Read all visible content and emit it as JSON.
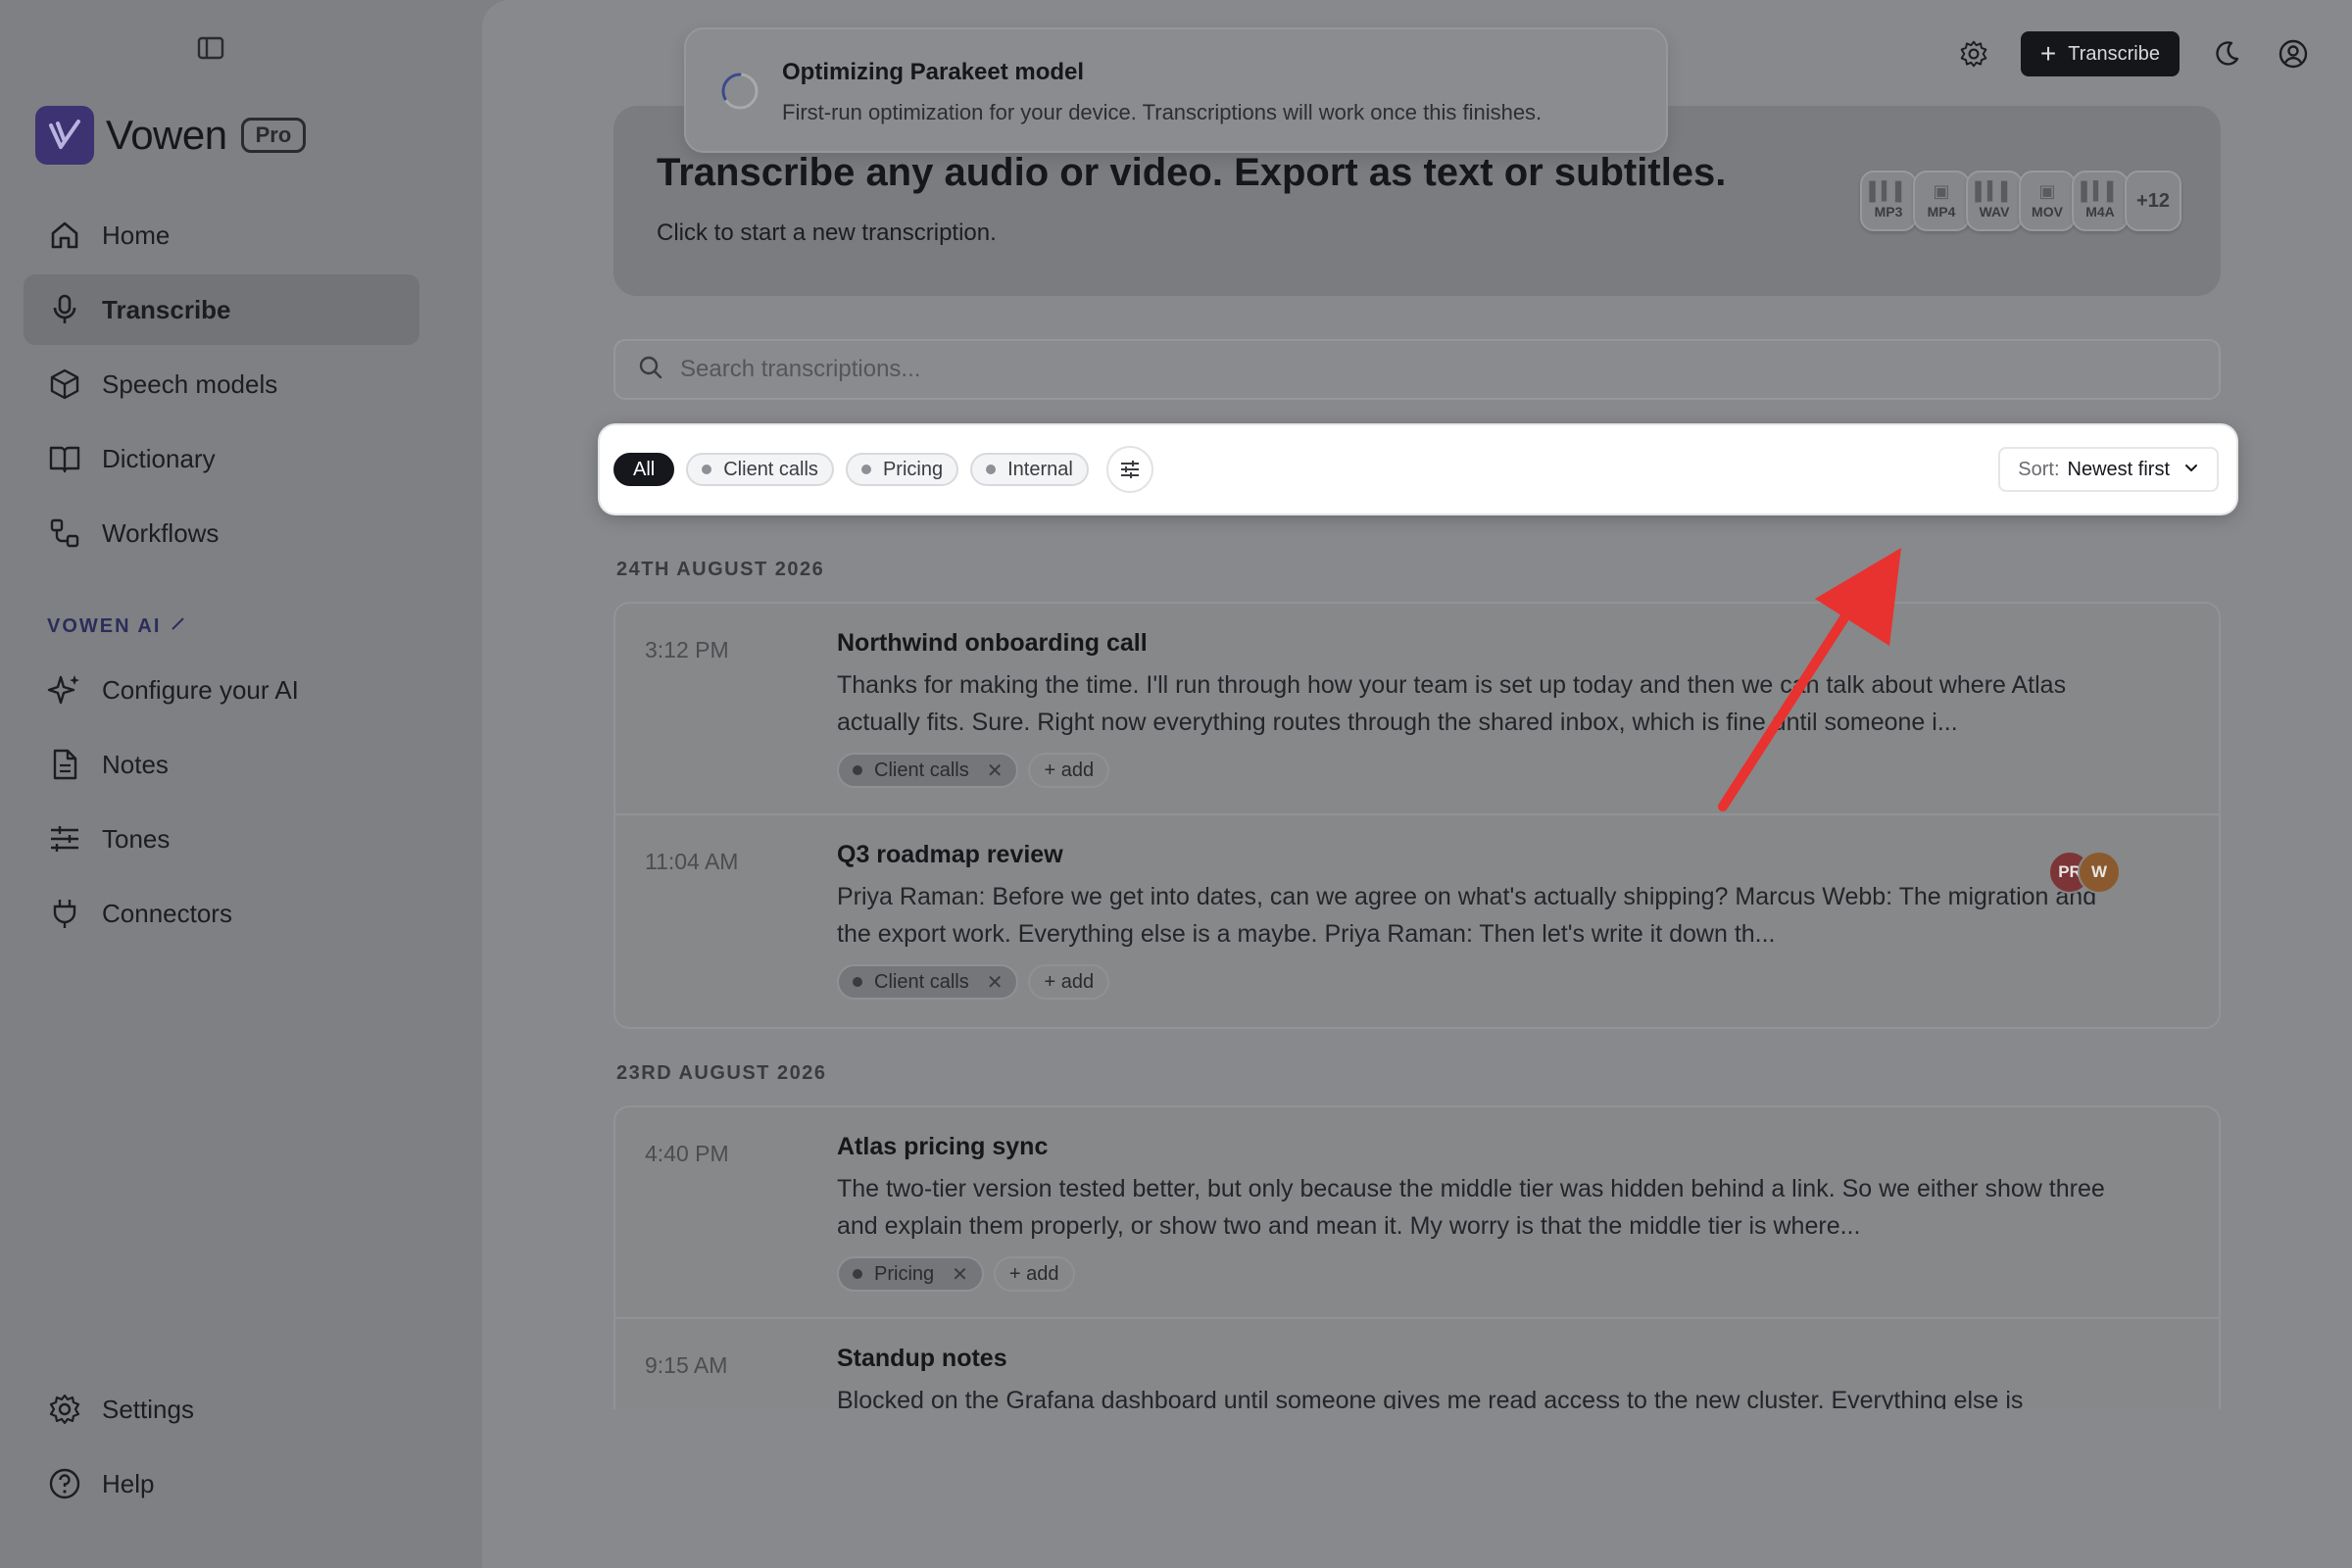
{
  "app": {
    "name": "Vowen",
    "plan_badge": "Pro"
  },
  "sidebar": {
    "items": [
      {
        "label": "Home",
        "icon": "home-icon"
      },
      {
        "label": "Transcribe",
        "icon": "microphone-icon",
        "active": true
      },
      {
        "label": "Speech models",
        "icon": "cube-icon"
      },
      {
        "label": "Dictionary",
        "icon": "book-icon"
      },
      {
        "label": "Workflows",
        "icon": "workflow-icon"
      }
    ],
    "ai_section_label": "VOWEN AI",
    "ai_items": [
      {
        "label": "Configure your AI",
        "icon": "sparkles-icon"
      },
      {
        "label": "Notes",
        "icon": "document-icon"
      },
      {
        "label": "Tones",
        "icon": "sliders-icon"
      },
      {
        "label": "Connectors",
        "icon": "plug-icon"
      }
    ],
    "footer_items": [
      {
        "label": "Settings",
        "icon": "gear-icon"
      },
      {
        "label": "Help",
        "icon": "help-icon"
      }
    ]
  },
  "topbar": {
    "transcribe_label": "Transcribe"
  },
  "toast": {
    "title": "Optimizing Parakeet model",
    "message": "First-run optimization for your device. Transcriptions will work once this finishes."
  },
  "hero": {
    "title": "Transcribe any audio or video. Export as text or subtitles.",
    "subtitle": "Click to start a new transcription.",
    "formats": [
      "MP3",
      "MP4",
      "WAV",
      "MOV",
      "M4A"
    ],
    "more_formats": "+12"
  },
  "search": {
    "placeholder": "Search transcriptions..."
  },
  "filters": {
    "chips": [
      "All",
      "Client calls",
      "Pricing",
      "Internal"
    ],
    "active": "All",
    "sort_label": "Sort:",
    "sort_value": "Newest first"
  },
  "groups": [
    {
      "date": "24TH AUGUST 2026",
      "entries": [
        {
          "time": "3:12 PM",
          "title": "Northwind onboarding call",
          "body": "Thanks for making the time. I'll run through how your team is set up today and then we can talk about where Atlas actually fits. Sure. Right now everything routes through the shared inbox, which is fine until someone i...",
          "tag": "Client calls",
          "add_label": "+ add"
        },
        {
          "time": "11:04 AM",
          "title": "Q3 roadmap review",
          "body": "Priya Raman: Before we get into dates, can we agree on what's actually shipping? Marcus Webb: The migration and the export work. Everything else is a maybe. Priya Raman: Then let's write it down th...",
          "tag": "Client calls",
          "add_label": "+ add",
          "avatars": [
            "PR",
            "W"
          ]
        }
      ]
    },
    {
      "date": "23RD AUGUST 2026",
      "entries": [
        {
          "time": "4:40 PM",
          "title": "Atlas pricing sync",
          "body": "The two-tier version tested better, but only because the middle tier was hidden behind a link. So we either show three and explain them properly, or show two and mean it. My worry is that the middle tier is where...",
          "tag": "Pricing",
          "add_label": "+ add"
        },
        {
          "time": "9:15 AM",
          "title": "Standup notes",
          "body": "Blocked on the Grafana dashboard until someone gives me read access to the new cluster. Everything else is"
        }
      ]
    }
  ],
  "colors": {
    "accent": "#3d3372",
    "highlight_arrow": "#e8322f",
    "primary_button": "#151619"
  }
}
